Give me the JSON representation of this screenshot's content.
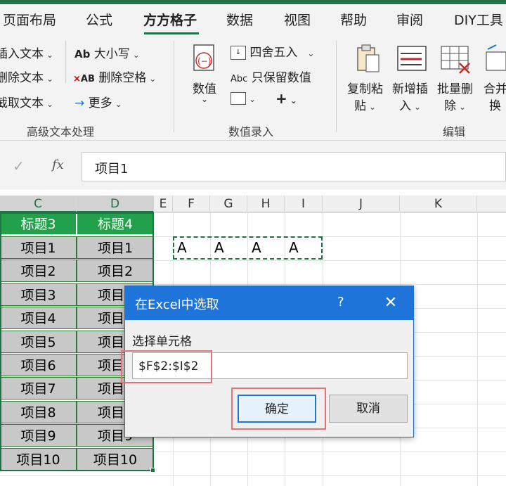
{
  "tabs": [
    "页面布局",
    "公式",
    "方方格子",
    "数据",
    "视图",
    "帮助",
    "审阅",
    "DIY工具"
  ],
  "ribbon": {
    "text_group": {
      "items": [
        "插入文本",
        "删除文本",
        "截取文本"
      ],
      "items2": [
        "大小写",
        "删除空格",
        "更多"
      ],
      "label": "高级文本处理"
    },
    "value_group": {
      "big_button": "数值",
      "round": "四舍五入",
      "keep_values": "只保留数值",
      "plus": "+",
      "label": "数值录入"
    },
    "edit_group": {
      "copy_paste": [
        "复制粘",
        "贴"
      ],
      "insert": [
        "新增插",
        "入"
      ],
      "batch_delete": [
        "批量删",
        "除"
      ],
      "merge": [
        "合并",
        "换"
      ],
      "label": "编辑"
    }
  },
  "formula_bar": {
    "cancel": "✓",
    "fx": "fx",
    "value": "项目1"
  },
  "columns": [
    "C",
    "D",
    "E",
    "F",
    "G",
    "H",
    "I",
    "J",
    "K"
  ],
  "sheet": {
    "headers": [
      "标题3",
      "标题4"
    ],
    "rows": [
      [
        "项目1",
        "项目1"
      ],
      [
        "项目2",
        "项目2"
      ],
      [
        "项目3",
        "项目3"
      ],
      [
        "项目4",
        "项目4"
      ],
      [
        "项目5",
        "项目5"
      ],
      [
        "项目6",
        "项目6"
      ],
      [
        "项目7",
        "项目7"
      ],
      [
        "项目8",
        "项目8"
      ],
      [
        "项目9",
        "项目9"
      ],
      [
        "项目10",
        "项目10"
      ]
    ],
    "a_cells": [
      "A",
      "A",
      "A",
      "A"
    ]
  },
  "dialog": {
    "title": "在Excel中选取",
    "help": "?",
    "close": "✕",
    "label": "选择单元格",
    "value": "$F$2:$I$2",
    "ok": "确定",
    "cancel": "取消"
  }
}
